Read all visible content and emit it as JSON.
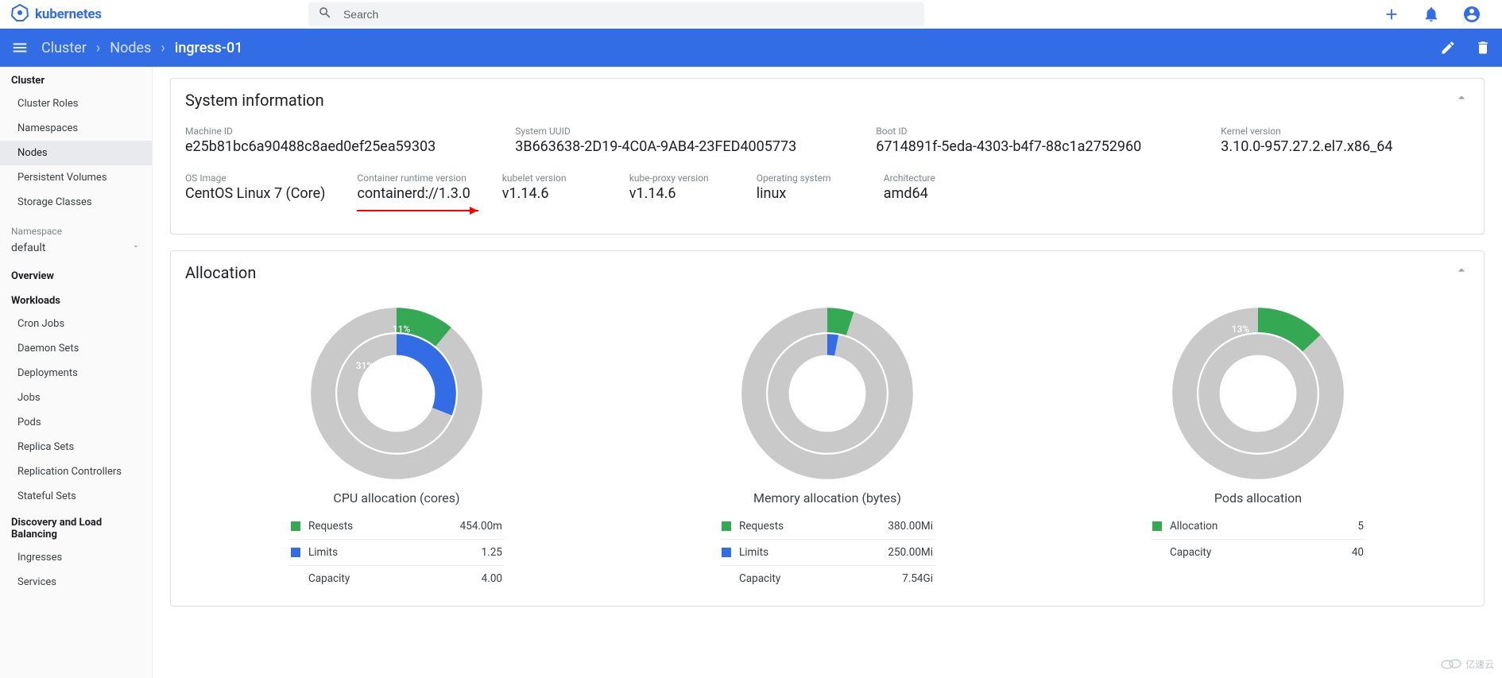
{
  "brand": {
    "name": "kubernetes"
  },
  "search": {
    "placeholder": "Search"
  },
  "breadcrumb": {
    "l1": "Cluster",
    "l2": "Nodes",
    "l3": "ingress-01"
  },
  "sidebar": {
    "cluster_group": {
      "title": "Cluster",
      "items": [
        "Cluster Roles",
        "Namespaces",
        "Nodes",
        "Persistent Volumes",
        "Storage Classes"
      ],
      "active_index": 2
    },
    "namespace": {
      "label": "Namespace",
      "value": "default"
    },
    "overview": "Overview",
    "workloads_group": {
      "title": "Workloads",
      "items": [
        "Cron Jobs",
        "Daemon Sets",
        "Deployments",
        "Jobs",
        "Pods",
        "Replica Sets",
        "Replication Controllers",
        "Stateful Sets"
      ]
    },
    "discovery_group": {
      "title": "Discovery and Load Balancing",
      "items": [
        "Ingresses",
        "Services"
      ]
    }
  },
  "sysinfo": {
    "title": "System information",
    "row1": [
      {
        "label": "Machine ID",
        "value": "e25b81bc6a90488c8aed0ef25ea59303"
      },
      {
        "label": "System UUID",
        "value": "3B663638-2D19-4C0A-9AB4-23FED4005773"
      },
      {
        "label": "Boot ID",
        "value": "6714891f-5eda-4303-b4f7-88c1a2752960"
      },
      {
        "label": "Kernel version",
        "value": "3.10.0-957.27.2.el7.x86_64"
      }
    ],
    "row2": [
      {
        "label": "OS Image",
        "value": "CentOS Linux 7 (Core)"
      },
      {
        "label": "Container runtime version",
        "value": "containerd://1.3.0"
      },
      {
        "label": "kubelet version",
        "value": "v1.14.6"
      },
      {
        "label": "kube-proxy version",
        "value": "v1.14.6"
      },
      {
        "label": "Operating system",
        "value": "linux"
      },
      {
        "label": "Architecture",
        "value": "amd64"
      }
    ]
  },
  "allocation": {
    "title": "Allocation",
    "colors": {
      "green": "#34a853",
      "blue": "#326de6",
      "grey": "#c7c7c7",
      "grey_inner": "#d6d6d6"
    },
    "labels": {
      "requests": "Requests",
      "limits": "Limits",
      "capacity": "Capacity",
      "allocation": "Allocation"
    },
    "cpu": {
      "title": "CPU allocation (cores)",
      "requests_text": "454.00m",
      "limits_text": "1.25",
      "capacity_text": "4.00",
      "requests_pct": 11,
      "limits_pct": 31,
      "pct1_label": "11%",
      "pct2_label": "31%"
    },
    "memory": {
      "title": "Memory allocation (bytes)",
      "requests_text": "380.00Mi",
      "limits_text": "250.00Mi",
      "capacity_text": "7.54Gi",
      "requests_pct": 5,
      "limits_pct": 3
    },
    "pods": {
      "title": "Pods allocation",
      "allocation_text": "5",
      "capacity_text": "40",
      "allocation_pct": 13,
      "pct_label": "13%"
    }
  },
  "chart_data": [
    {
      "type": "pie",
      "title": "CPU allocation (cores)",
      "series": [
        {
          "name": "Requests",
          "value_pct": 11,
          "value_label": "454.00m",
          "color": "#34a853"
        },
        {
          "name": "Limits",
          "value_pct": 31,
          "value_label": "1.25",
          "color": "#326de6"
        }
      ],
      "capacity": {
        "label": "Capacity",
        "value_label": "4.00"
      }
    },
    {
      "type": "pie",
      "title": "Memory allocation (bytes)",
      "series": [
        {
          "name": "Requests",
          "value_pct": 5,
          "value_label": "380.00Mi",
          "color": "#34a853"
        },
        {
          "name": "Limits",
          "value_pct": 3,
          "value_label": "250.00Mi",
          "color": "#326de6"
        }
      ],
      "capacity": {
        "label": "Capacity",
        "value_label": "7.54Gi"
      }
    },
    {
      "type": "pie",
      "title": "Pods allocation",
      "series": [
        {
          "name": "Allocation",
          "value_pct": 13,
          "value_label": "5",
          "color": "#34a853"
        }
      ],
      "capacity": {
        "label": "Capacity",
        "value_label": "40"
      }
    }
  ],
  "watermark": "亿速云"
}
